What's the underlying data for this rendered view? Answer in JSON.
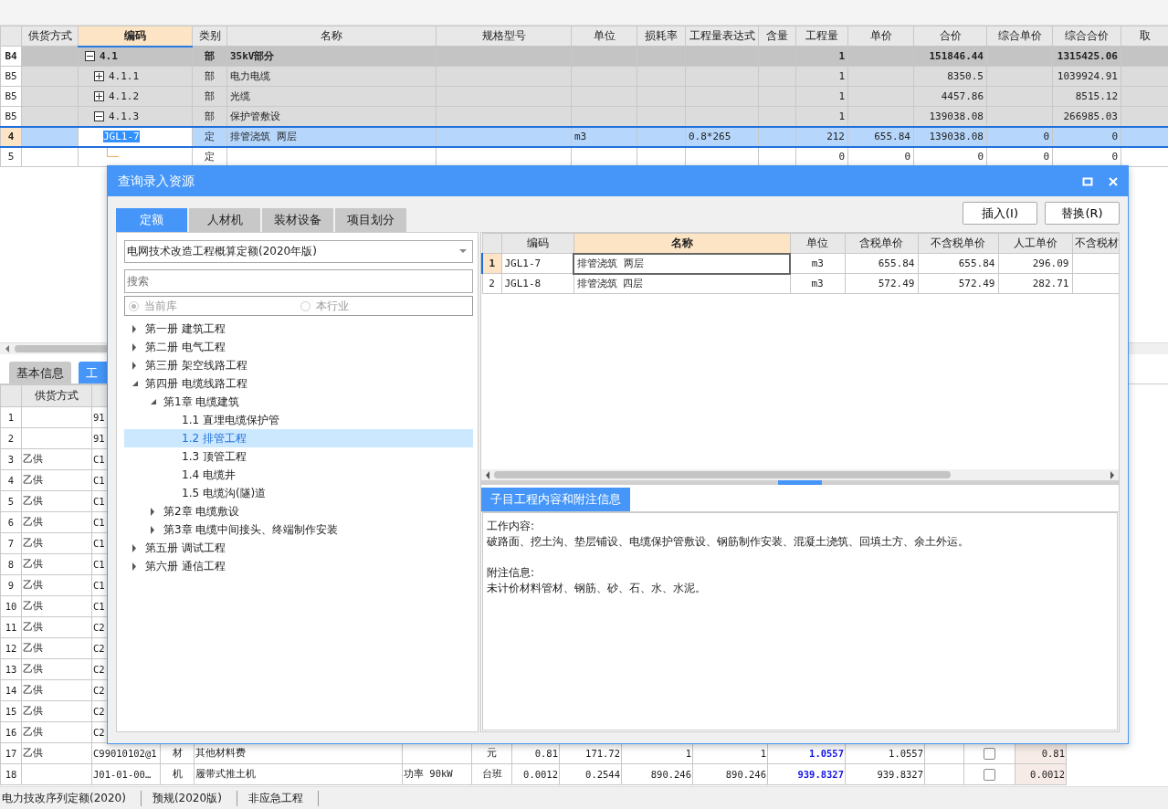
{
  "main_table": {
    "columns": [
      {
        "label": "供货方式",
        "selected": false
      },
      {
        "label": "编码",
        "selected": true
      },
      {
        "label": "类别",
        "selected": false
      },
      {
        "label": "名称",
        "selected": false
      },
      {
        "label": "规格型号",
        "selected": false
      },
      {
        "label": "单位",
        "selected": false
      },
      {
        "label": "损耗率",
        "selected": false
      },
      {
        "label": "工程量表达式",
        "selected": false
      },
      {
        "label": "含量",
        "selected": false
      },
      {
        "label": "工程量",
        "selected": false
      },
      {
        "label": "单价",
        "selected": false
      },
      {
        "label": "合价",
        "selected": false
      },
      {
        "label": "综合单价",
        "selected": false
      },
      {
        "label": "综合合价",
        "selected": false
      },
      {
        "label": "取",
        "selected": false
      }
    ],
    "rows": [
      {
        "label": "B4",
        "kind": "section",
        "selected": false,
        "expanded": true,
        "cells": [
          null,
          "4.1",
          "部",
          "35kV部分",
          null,
          null,
          null,
          null,
          null,
          "1",
          null,
          "151846.44",
          null,
          "1315425.06",
          null
        ],
        "children": [
          {
            "label": "B5",
            "kind": "subsection",
            "selected": false,
            "expanded": false,
            "cells": [
              null,
              "4.1.1",
              "部",
              "电力电缆",
              null,
              null,
              null,
              null,
              null,
              "1",
              null,
              "8350.5",
              null,
              "1039924.91",
              null
            ]
          },
          {
            "label": "B5",
            "kind": "subsection",
            "selected": false,
            "expanded": false,
            "cells": [
              null,
              "4.1.2",
              "部",
              "光缆",
              null,
              null,
              null,
              null,
              null,
              "1",
              null,
              "4457.86",
              null,
              "8515.12",
              null
            ]
          },
          {
            "label": "B5",
            "kind": "subsection",
            "selected": false,
            "expanded": true,
            "cells": [
              null,
              "4.1.3",
              "部",
              "保护管敷设",
              null,
              null,
              null,
              null,
              null,
              "1",
              null,
              "139038.08",
              null,
              "266985.03",
              null
            ],
            "children": [
              {
                "label": "4",
                "kind": "item",
                "selected": true,
                "cells": [
                  null,
                  "JGL1-7",
                  "定",
                  "排管浇筑 两层",
                  null,
                  "m3",
                  null,
                  "0.8*265",
                  null,
                  "212",
                  "655.84",
                  "139038.08",
                  "0",
                  "0",
                  null
                ]
              },
              {
                "label": "5",
                "kind": "item",
                "selected": false,
                "cells": [
                  null,
                  null,
                  "定",
                  null,
                  null,
                  null,
                  null,
                  null,
                  null,
                  "0",
                  "0",
                  "0",
                  "0",
                  "0",
                  null
                ]
              }
            ]
          }
        ]
      }
    ]
  },
  "bottom_tabs": [
    {
      "label": "基本信息",
      "selected": false
    },
    {
      "label": "工",
      "selected": true
    }
  ],
  "bottom_table": {
    "columns": [
      "供货方式"
    ],
    "rows": [
      {
        "label": "1",
        "cells": [
          null,
          "91"
        ]
      },
      {
        "label": "2",
        "cells": [
          null,
          "91"
        ]
      },
      {
        "label": "3",
        "cells": [
          "乙供",
          "C1"
        ]
      },
      {
        "label": "4",
        "cells": [
          "乙供",
          "C1"
        ]
      },
      {
        "label": "5",
        "cells": [
          "乙供",
          "C1"
        ]
      },
      {
        "label": "6",
        "cells": [
          "乙供",
          "C1"
        ]
      },
      {
        "label": "7",
        "cells": [
          "乙供",
          "C1"
        ]
      },
      {
        "label": "8",
        "cells": [
          "乙供",
          "C1"
        ]
      },
      {
        "label": "9",
        "cells": [
          "乙供",
          "C1"
        ]
      },
      {
        "label": "10",
        "cells": [
          "乙供",
          "C1"
        ]
      },
      {
        "label": "11",
        "cells": [
          "乙供",
          "C2"
        ]
      },
      {
        "label": "12",
        "cells": [
          "乙供",
          "C2"
        ]
      },
      {
        "label": "13",
        "cells": [
          "乙供",
          "C2"
        ]
      },
      {
        "label": "14",
        "cells": [
          "乙供",
          "C2"
        ]
      },
      {
        "label": "15",
        "cells": [
          "乙供",
          "C2"
        ]
      },
      {
        "label": "16",
        "cells": [
          "乙供",
          "C2"
        ]
      },
      {
        "label": "17",
        "cells": [
          "乙供",
          "C99010102@1",
          "材",
          "其他材料费",
          null,
          "元",
          "0.81",
          "171.72",
          "1",
          "1",
          "1.0557",
          "1.0557",
          null
        ],
        "checked": false,
        "last": "0.81"
      },
      {
        "label": "18",
        "cells": [
          null,
          "J01-01-00…",
          "机",
          "履带式推土机",
          "功率 90kW",
          "台班",
          "0.0012",
          "0.2544",
          "890.246",
          "890.246",
          "939.8327",
          "939.8327",
          null
        ],
        "checked": false,
        "last": "0.0012"
      }
    ]
  },
  "status_bar": [
    "电力技改序列定额(2020)",
    "预规(2020版)",
    "非应急工程"
  ],
  "dialog": {
    "title": "查询录入资源",
    "tabs": [
      {
        "label": "定额",
        "selected": true
      },
      {
        "label": "人材机",
        "selected": false
      },
      {
        "label": "装材设备",
        "selected": false
      },
      {
        "label": "项目划分",
        "selected": false
      }
    ],
    "buttons": [
      "插入(I)",
      "替换(R)"
    ],
    "library": {
      "value": "电网技术改造工程概算定额(2020年版)"
    },
    "search": {
      "placeholder": "搜索"
    },
    "scope": [
      {
        "label": "当前库",
        "selected": true,
        "disabled": true
      },
      {
        "label": "本行业",
        "selected": false,
        "disabled": true
      }
    ],
    "tree": [
      {
        "label": "第一册 建筑工程",
        "expanded": false,
        "selected": false
      },
      {
        "label": "第二册 电气工程",
        "expanded": false,
        "selected": false
      },
      {
        "label": "第三册 架空线路工程",
        "expanded": false,
        "selected": false
      },
      {
        "label": "第四册 电缆线路工程",
        "expanded": true,
        "selected": false,
        "children": [
          {
            "label": "第1章 电缆建筑",
            "expanded": true,
            "selected": false,
            "children": [
              {
                "label": "1.1 直埋电缆保护管",
                "selected": false
              },
              {
                "label": "1.2 排管工程",
                "selected": true
              },
              {
                "label": "1.3 顶管工程",
                "selected": false
              },
              {
                "label": "1.4 电缆井",
                "selected": false
              },
              {
                "label": "1.5 电缆沟(隧)道",
                "selected": false
              }
            ]
          },
          {
            "label": "第2章 电缆敷设",
            "expanded": false,
            "selected": false
          },
          {
            "label": "第3章 电缆中间接头、终端制作安装",
            "expanded": false,
            "selected": false
          }
        ]
      },
      {
        "label": "第五册 调试工程",
        "expanded": false,
        "selected": false
      },
      {
        "label": "第六册 通信工程",
        "expanded": false,
        "selected": false
      }
    ],
    "grid": {
      "columns": [
        {
          "label": "编码",
          "selected": false
        },
        {
          "label": "名称",
          "selected": true
        },
        {
          "label": "单位",
          "selected": false
        },
        {
          "label": "含税单价",
          "selected": false
        },
        {
          "label": "不含税单价",
          "selected": false
        },
        {
          "label": "人工单价",
          "selected": false
        },
        {
          "label": "不含税材",
          "selected": false
        }
      ],
      "rows": [
        {
          "label": "1",
          "selected": true,
          "cells": [
            "JGL1-7",
            "排管浇筑 两层",
            "m3",
            "655.84",
            "655.84",
            "296.09"
          ]
        },
        {
          "label": "2",
          "selected": false,
          "cells": [
            "JGL1-8",
            "排管浇筑 四层",
            "m3",
            "572.49",
            "572.49",
            "282.71"
          ]
        }
      ]
    },
    "info_tab": "子目工程内容和附注信息",
    "info": [
      {
        "heading": "工作内容:",
        "text": "破路面、挖土沟、垫层铺设、电缆保护管敷设、钢筋制作安装、混凝土浇筑、回填土方、余土外运。"
      },
      {
        "heading": "附注信息:",
        "text": "未计价材料管材、钢筋、砂、石、水、水泥。"
      }
    ]
  }
}
